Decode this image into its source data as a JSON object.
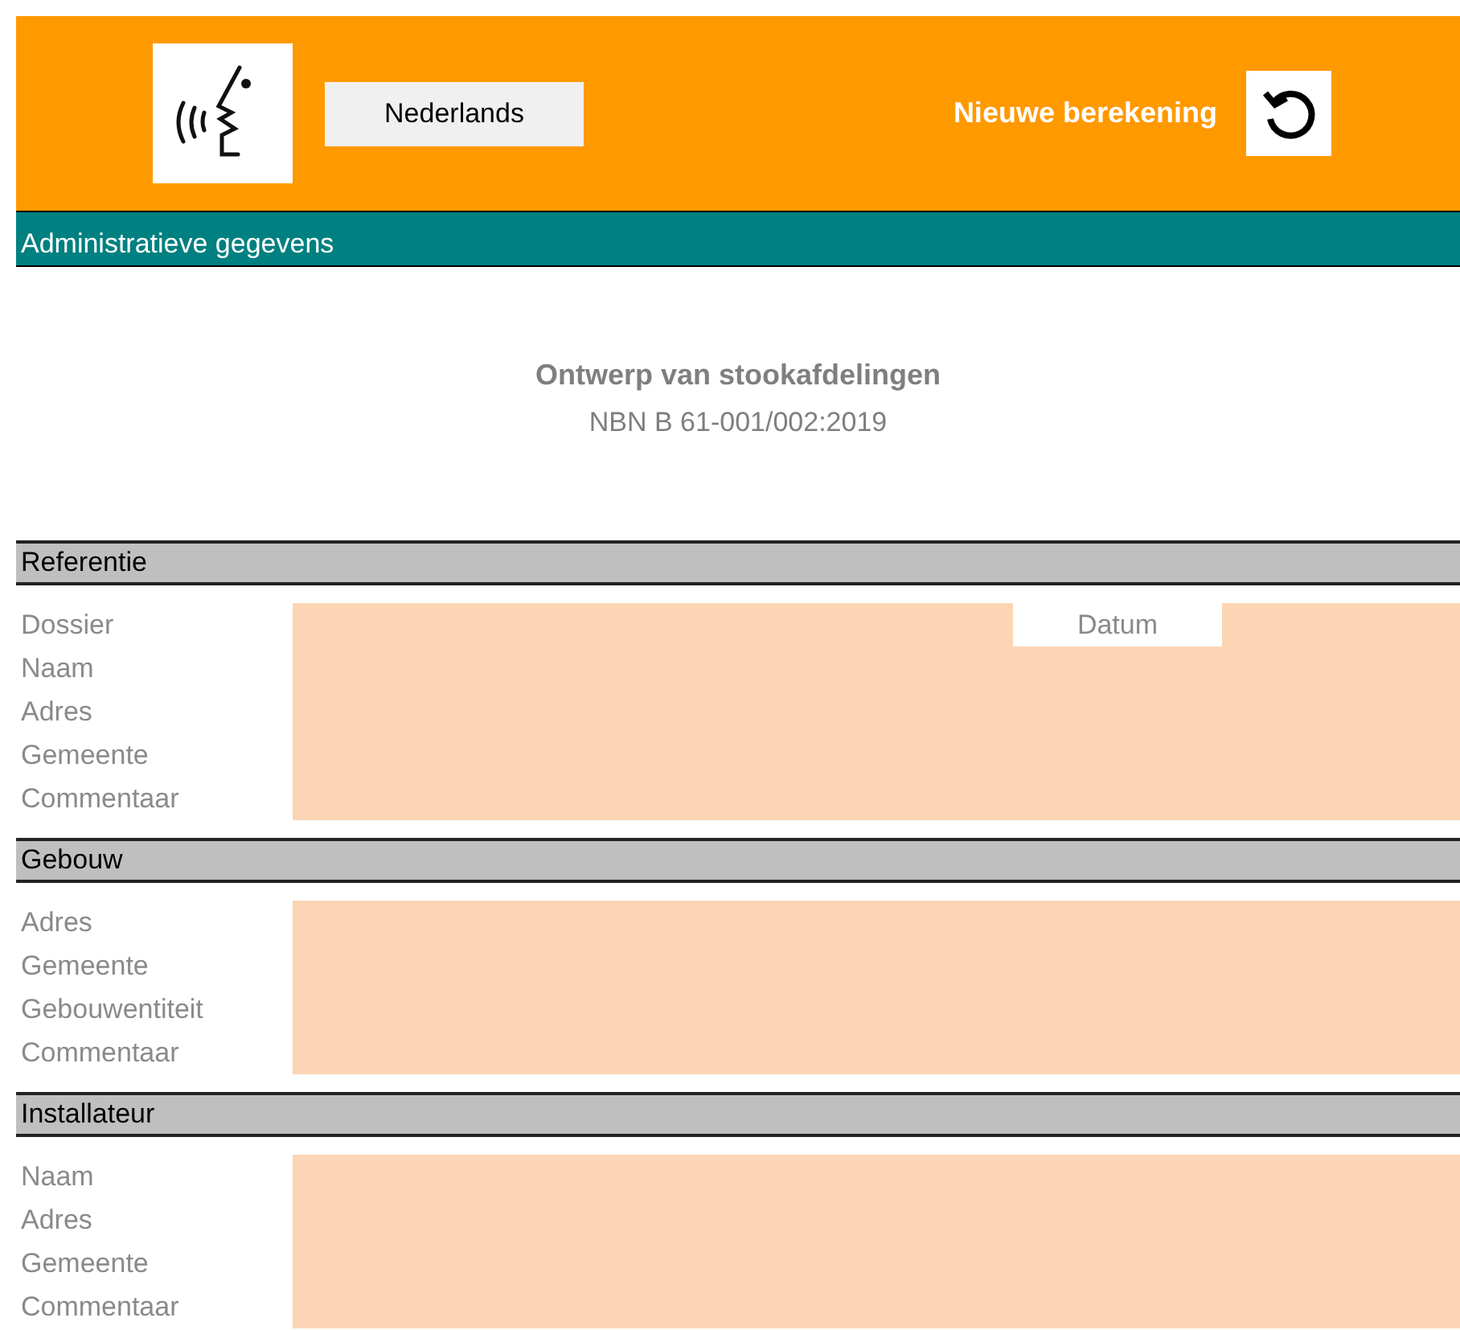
{
  "header": {
    "language_button": "Nederlands",
    "new_calculation_label": "Nieuwe berekening"
  },
  "section_bar": "Administratieve gegevens",
  "title": "Ontwerp van stookafdelingen",
  "subtitle": "NBN B 61-001/002:2019",
  "sections": [
    {
      "title": "Referentie",
      "fields": [
        {
          "label": "Dossier",
          "side_label": "Datum"
        },
        {
          "label": "Naam"
        },
        {
          "label": "Adres"
        },
        {
          "label": "Gemeente"
        },
        {
          "label": "Commentaar"
        }
      ]
    },
    {
      "title": "Gebouw",
      "fields": [
        {
          "label": "Adres"
        },
        {
          "label": "Gemeente"
        },
        {
          "label": "Gebouwentiteit"
        },
        {
          "label": "Commentaar"
        }
      ]
    },
    {
      "title": "Installateur",
      "fields": [
        {
          "label": "Naam"
        },
        {
          "label": "Adres"
        },
        {
          "label": "Gemeente"
        },
        {
          "label": "Commentaar"
        }
      ]
    }
  ]
}
